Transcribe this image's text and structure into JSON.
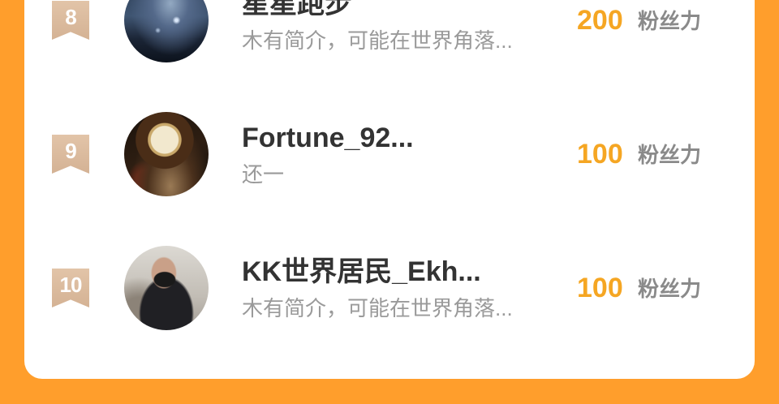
{
  "colors": {
    "background": "#FF9E2C",
    "card": "#FFFFFF",
    "rank_badge": "#D8B89B",
    "name": "#333333",
    "bio": "#9A9A9A",
    "score": "#F5A623",
    "unit": "#8A8A8A"
  },
  "rows": [
    {
      "rank": "8",
      "name": "星星跑步",
      "bio": "木有简介，可能在世界角落...",
      "score": "200",
      "unit": "粉丝力"
    },
    {
      "rank": "9",
      "name": "Fortune_92...",
      "bio": "还一",
      "score": "100",
      "unit": "粉丝力"
    },
    {
      "rank": "10",
      "name": "KK世界居民_Ekh...",
      "bio": "木有简介，可能在世界角落...",
      "score": "100",
      "unit": "粉丝力"
    }
  ]
}
